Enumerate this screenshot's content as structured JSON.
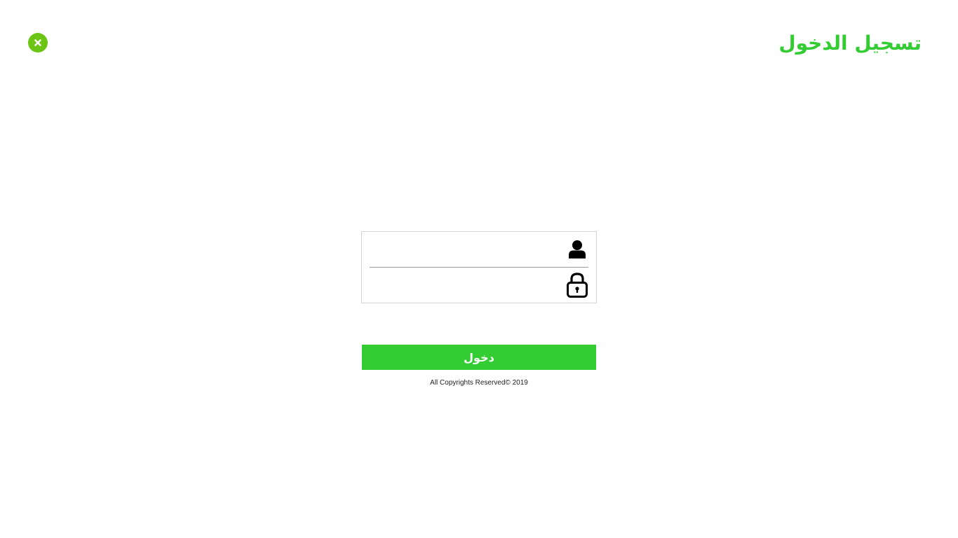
{
  "header": {
    "title": "تسجيل الدخول",
    "close_icon": "close-icon"
  },
  "form": {
    "username": {
      "value": "",
      "placeholder": "",
      "icon": "user-icon"
    },
    "password": {
      "value": "",
      "placeholder": "",
      "icon": "lock-icon"
    },
    "submit_label": "دخول"
  },
  "footer": {
    "copyright": "All Copyrights Reserved© 2019"
  },
  "colors": {
    "accent": "#33cc33",
    "close_button": "#6cc514",
    "box_border": "#d4d4d4"
  }
}
